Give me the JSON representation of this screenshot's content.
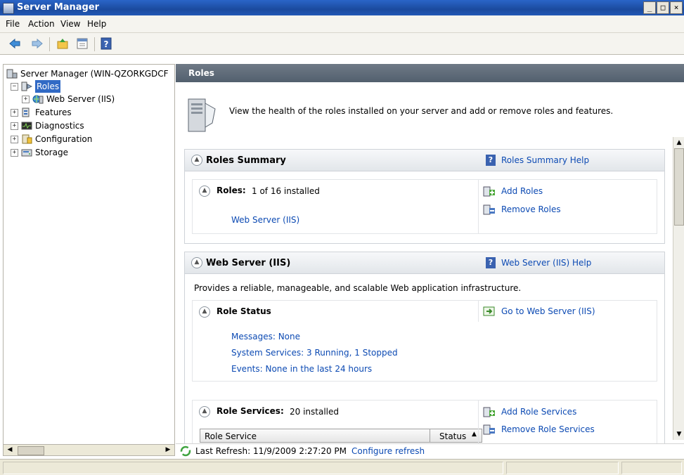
{
  "window": {
    "title": "Server Manager"
  },
  "menu": [
    "File",
    "Action",
    "View",
    "Help"
  ],
  "tree": {
    "root": "Server Manager (WIN-QZORKGDCF",
    "roles": "Roles",
    "web_server": "Web Server (IIS)",
    "features": "Features",
    "diagnostics": "Diagnostics",
    "configuration": "Configuration",
    "storage": "Storage"
  },
  "main": {
    "header": "Roles",
    "intro": "View the health of the roles installed on your server and add or remove roles and features.",
    "roles_summary": {
      "title": "Roles Summary",
      "help": "Roles Summary Help",
      "roles_label": "Roles:",
      "roles_count": "1 of 16 installed",
      "installed_role": "Web Server (IIS)",
      "add": "Add Roles",
      "remove": "Remove Roles"
    },
    "web_server": {
      "title": "Web Server (IIS)",
      "help": "Web Server (IIS) Help",
      "description": "Provides a reliable, manageable, and scalable Web application infrastructure.",
      "role_status": {
        "title": "Role Status",
        "goto": "Go to Web Server (IIS)",
        "messages": "Messages: None",
        "services": "System Services: 3 Running, 1 Stopped",
        "events": "Events: None in the last 24 hours"
      },
      "role_services": {
        "title": "Role Services:",
        "count": "20 installed",
        "add": "Add Role Services",
        "remove": "Remove Role Services",
        "col_service": "Role Service",
        "col_status": "Status"
      }
    },
    "refresh": {
      "text": "Last Refresh: 11/9/2009 2:27:20 PM",
      "configure": "Configure refresh"
    }
  }
}
